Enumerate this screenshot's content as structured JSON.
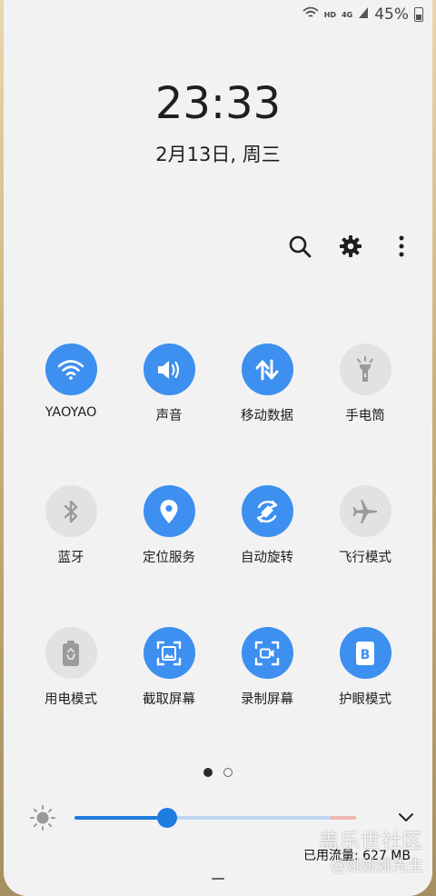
{
  "status_bar": {
    "network_badge_hd": "HD",
    "network_badge_4g": "4G",
    "battery_percent": "45%",
    "icons": [
      "wifi-icon",
      "signal-icon",
      "battery-icon"
    ]
  },
  "lock": {
    "time": "23:33",
    "date": "2月13日, 周三"
  },
  "actions": [
    "search-icon",
    "settings-gear-icon",
    "more-vertical-icon"
  ],
  "tiles": [
    {
      "label": "YAOYAO",
      "icon": "wifi-icon",
      "on": true
    },
    {
      "label": "声音",
      "icon": "sound-icon",
      "on": true
    },
    {
      "label": "移动数据",
      "icon": "mobile-data-icon",
      "on": true
    },
    {
      "label": "手电筒",
      "icon": "flashlight-icon",
      "on": false
    },
    {
      "label": "蓝牙",
      "icon": "bluetooth-icon",
      "on": false
    },
    {
      "label": "定位服务",
      "icon": "location-icon",
      "on": true
    },
    {
      "label": "自动旋转",
      "icon": "auto-rotate-icon",
      "on": true
    },
    {
      "label": "飞行模式",
      "icon": "airplane-icon",
      "on": false
    },
    {
      "label": "用电模式",
      "icon": "power-mode-icon",
      "on": false
    },
    {
      "label": "截取屏幕",
      "icon": "screenshot-icon",
      "on": true
    },
    {
      "label": "录制屏幕",
      "icon": "screen-record-icon",
      "on": true
    },
    {
      "label": "护眼模式",
      "icon": "eye-comfort-icon",
      "on": true
    }
  ],
  "pager": {
    "pages": 2,
    "current": 1
  },
  "brightness": {
    "level": 0.33
  },
  "data_usage": "已用流量: 627 MB",
  "watermark": {
    "title": "盖乐世社区",
    "user": "@姚姚姚先生"
  },
  "colors": {
    "accent": "#3d8ff0",
    "tile_off": "#e2e2e2",
    "panel_bg": "#f2f2f2"
  }
}
